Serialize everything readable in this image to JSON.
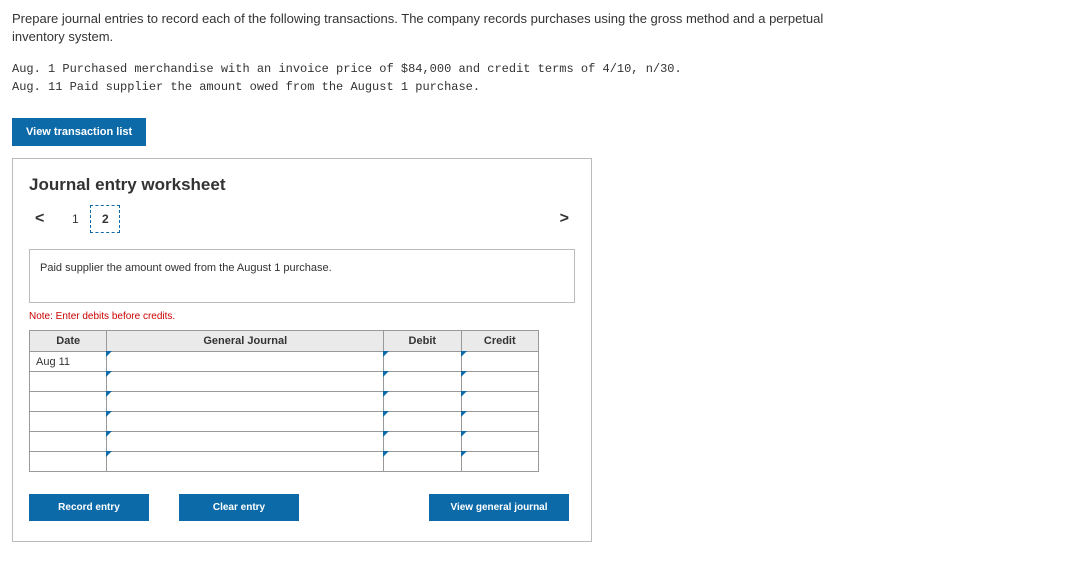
{
  "instructions": "Prepare journal entries to record each of the following transactions. The company records purchases using the gross method and a perpetual inventory system.",
  "transactions": {
    "line1": "Aug.  1 Purchased merchandise with an invoice price of $84,000 and credit terms of 4/10, n/30.",
    "line2": "Aug. 11 Paid supplier the amount owed from the August 1 purchase."
  },
  "buttons": {
    "view_list": "View transaction list",
    "record": "Record entry",
    "clear": "Clear entry",
    "view_journal": "View general journal"
  },
  "worksheet": {
    "title": "Journal entry worksheet",
    "prev": "<",
    "next": ">",
    "tab1": "1",
    "tab2": "2",
    "description": "Paid supplier the amount owed from the August 1 purchase.",
    "note": "Note: Enter debits before credits.",
    "headers": {
      "date": "Date",
      "gj": "General Journal",
      "debit": "Debit",
      "credit": "Credit"
    },
    "rows": {
      "r0_date": "Aug 11"
    }
  }
}
